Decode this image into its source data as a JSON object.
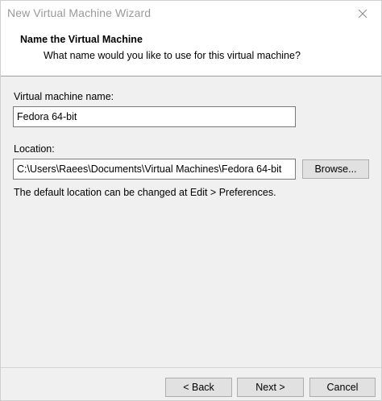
{
  "window": {
    "title": "New Virtual Machine Wizard"
  },
  "header": {
    "title": "Name the Virtual Machine",
    "subtitle": "What name would you like to use for this virtual machine?"
  },
  "form": {
    "name_label": "Virtual machine name:",
    "name_value": "Fedora 64-bit",
    "location_label": "Location:",
    "location_value": "C:\\Users\\Raees\\Documents\\Virtual Machines\\Fedora 64-bit",
    "browse_label": "Browse...",
    "hint": "The default location can be changed at Edit > Preferences."
  },
  "footer": {
    "back_label": "< Back",
    "next_label": "Next >",
    "cancel_label": "Cancel"
  },
  "icons": {
    "close": "close-icon"
  }
}
